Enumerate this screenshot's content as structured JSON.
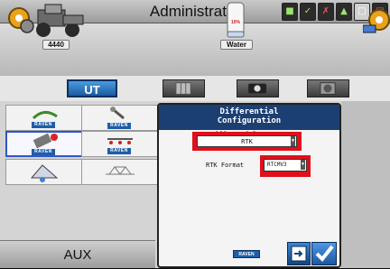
{
  "header": {
    "title": "Administrator",
    "status_icons": [
      "iso-icon",
      "gps-icon",
      "alert-icon",
      "gps-signal-icon",
      "lightbar-icon",
      "display-icon"
    ]
  },
  "machine": {
    "tractor_label": "4440",
    "tank_label": "Water",
    "tank_percent": "10%"
  },
  "tabs": [
    {
      "label": "UT",
      "active": true
    },
    {
      "label": "",
      "icon": "map-icon"
    },
    {
      "label": "",
      "icon": "camera-icon"
    },
    {
      "label": "",
      "icon": "gauge-icon"
    }
  ],
  "left_panel": {
    "badges": [
      "RAVEN",
      "RAVEN",
      "RAVEN",
      "RAVEN"
    ],
    "aux_label": "AUX"
  },
  "dialog": {
    "title_line1": "Differential",
    "title_line2": "Configuration",
    "source_label": "Differential Source:",
    "source_value": "RTK",
    "format_label": "RTK Format",
    "format_value": "RTCMV3",
    "brand": "RAVEN",
    "highlight_color": "#e0101a"
  }
}
